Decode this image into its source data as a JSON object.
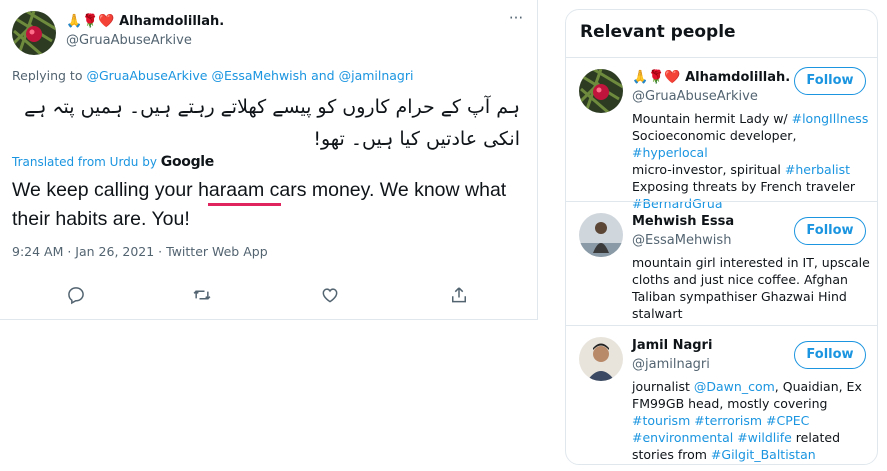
{
  "tweet": {
    "display_name": "Alhamdolillah.",
    "display_emoji": "🙏🌹❤️",
    "handle": "@GruaAbuseArkive",
    "more": "···",
    "replying_prefix": "Replying to",
    "replying_to": [
      "@GruaAbuseArkive",
      "@EssaMehwish",
      "@jamilnagri"
    ],
    "replying_and": "and",
    "urdu_text": "ہم آپ کے حرام کاروں کو پیسے کھلاتے رہتے ہیں۔ ہمیں پتہ ہے انکی عادتیں کیا ہیں۔ تھو!",
    "translated_label": "Translated from Urdu by",
    "translated_by": "Google",
    "translation": "We keep calling your haraam cars money. We know what their habits are. You!",
    "timestamp": "9:24 AM · Jan 26, 2021 · Twitter Web App",
    "actions": [
      "reply-icon",
      "retweet-icon",
      "like-icon",
      "share-icon"
    ]
  },
  "relevant_people": {
    "title": "Relevant people",
    "follow_label": "Follow",
    "people": [
      {
        "name": "Alhamdolillah.",
        "emoji": "🙏🌹❤️",
        "handle": "@GruaAbuseArkive",
        "bio": [
          [
            {
              "t": "Mountain hermit Lady w/ "
            },
            {
              "t": "#longIllness",
              "tag": true
            }
          ],
          [
            {
              "t": "Socioeconomic developer, "
            },
            {
              "t": "#hyperlocal",
              "tag": true
            }
          ],
          [
            {
              "t": "micro-investor, spiritual "
            },
            {
              "t": "#herbalist",
              "tag": true
            }
          ],
          [
            {
              "t": "Exposing threats by French traveler"
            }
          ],
          [
            {
              "t": "#BernardGrua",
              "tag": true
            }
          ]
        ]
      },
      {
        "name": "Mehwish Essa",
        "emoji": "",
        "handle": "@EssaMehwish",
        "bio": [
          [
            {
              "t": "mountain girl interested in IT, upscale"
            }
          ],
          [
            {
              "t": "cloths and just nice coffee. Afghan"
            }
          ],
          [
            {
              "t": "Taliban sympathiser Ghazwai Hind"
            }
          ],
          [
            {
              "t": "stalwart"
            }
          ]
        ]
      },
      {
        "name": "Jamil Nagri",
        "emoji": "",
        "handle": "@jamilnagri",
        "bio": [
          [
            {
              "t": "journalist "
            },
            {
              "t": "@Dawn_com",
              "tag": true
            },
            {
              "t": ", Quaidian, Ex"
            }
          ],
          [
            {
              "t": "FM99GB head, mostly covering"
            }
          ],
          [
            {
              "t": "#tourism",
              "tag": true
            },
            {
              "t": " "
            },
            {
              "t": "#terrorism",
              "tag": true
            },
            {
              "t": " "
            },
            {
              "t": "#CPEC",
              "tag": true
            }
          ],
          [
            {
              "t": "#environmental",
              "tag": true
            },
            {
              "t": " "
            },
            {
              "t": "#wildlife",
              "tag": true
            },
            {
              "t": " related"
            }
          ],
          [
            {
              "t": "stories from "
            },
            {
              "t": "#Gilgit_Baltistan",
              "tag": true
            }
          ]
        ]
      }
    ]
  },
  "colors": {
    "link": "#1b95e0",
    "underline": "#e0245e",
    "text": "#0f1419",
    "muted": "#536471"
  }
}
